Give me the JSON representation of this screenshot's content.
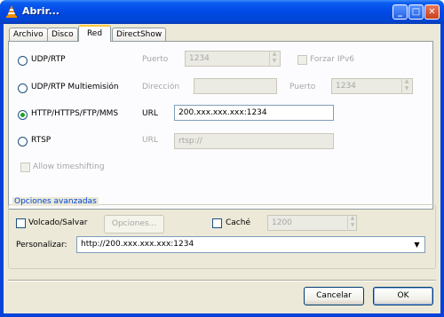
{
  "window": {
    "title": "Abrir...",
    "controls": {
      "minimize": "_",
      "maximize": "□",
      "close": "✕"
    }
  },
  "tabs": [
    {
      "label": "Archivo",
      "active": false
    },
    {
      "label": "Disco",
      "active": false
    },
    {
      "label": "Red",
      "active": true
    },
    {
      "label": "DirectShow",
      "active": false
    }
  ],
  "network": {
    "udp": {
      "label": "UDP/RTP",
      "selected": false,
      "port_label": "Puerto",
      "port_value": "1234",
      "ipv6_label": "Forzar IPv6",
      "ipv6_checked": false
    },
    "udp_multicast": {
      "label": "UDP/RTP Multiemisión",
      "selected": false,
      "address_label": "Dirección",
      "address_value": "",
      "port_label": "Puerto",
      "port_value": "1234"
    },
    "http": {
      "label": "HTTP/HTTPS/FTP/MMS",
      "selected": true,
      "url_label": "URL",
      "url_value": "200.xxx.xxx.xxx:1234"
    },
    "rtsp": {
      "label": "RTSP",
      "selected": false,
      "url_label": "URL",
      "url_value": "rtsp://"
    },
    "timeshift": {
      "label": "Allow timeshifting",
      "checked": false
    }
  },
  "advanced": {
    "title": "Opciones avanzadas",
    "dump_label": "Volcado/Salvar",
    "dump_checked": false,
    "options_button": "Opciones...",
    "cache_label": "Caché",
    "cache_checked": false,
    "cache_value": "1200",
    "customize_label": "Personalizar:",
    "customize_value": "http://200.xxx.xxx.xxx:1234"
  },
  "buttons": {
    "cancel": "Cancelar",
    "ok": "OK"
  },
  "colors": {
    "titlebar": "#0049e4",
    "dialog_bg": "#ece9d8",
    "group_title": "#0046d5",
    "active_tab_accent": "#ffc73c"
  }
}
